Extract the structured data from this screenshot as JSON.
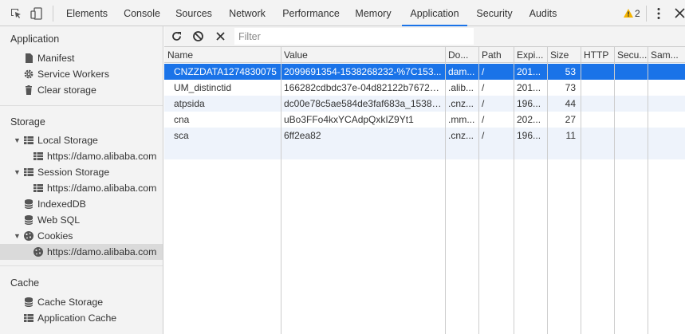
{
  "toolbar_tabs": [
    "Elements",
    "Console",
    "Sources",
    "Network",
    "Performance",
    "Memory",
    "Application",
    "Security",
    "Audits"
  ],
  "active_tab": "Application",
  "warning_count": "2",
  "colors": {
    "accent": "#1a73e8",
    "warning": "#f5b400",
    "selected_row": "#1a73e8"
  },
  "sidebar": {
    "application": {
      "title": "Application",
      "items": [
        "Manifest",
        "Service Workers",
        "Clear storage"
      ]
    },
    "storage": {
      "title": "Storage",
      "local_storage": {
        "label": "Local Storage",
        "child": "https://damo.alibaba.com"
      },
      "session_storage": {
        "label": "Session Storage",
        "child": "https://damo.alibaba.com"
      },
      "indexeddb": "IndexedDB",
      "websql": "Web SQL",
      "cookies": {
        "label": "Cookies",
        "child": "https://damo.alibaba.com"
      }
    },
    "cache": {
      "title": "Cache",
      "items": [
        "Cache Storage",
        "Application Cache"
      ]
    }
  },
  "cookie_toolbar": {
    "filter_placeholder": "Filter",
    "icons": [
      "refresh-icon",
      "clear-all-icon",
      "delete-selected-icon"
    ]
  },
  "table": {
    "columns": [
      "Name",
      "Value",
      "Do...",
      "Path",
      "Expi...",
      "Size",
      "HTTP",
      "Secu...",
      "Sam..."
    ],
    "rows": [
      {
        "name": "CNZZDATA1274830075",
        "value": "2099691354-1538268232-%7C153...",
        "domain": "dam...",
        "path": "/",
        "expires": "201...",
        "size": "53",
        "http": "",
        "secure": "",
        "samesite": ""
      },
      {
        "name": "UM_distinctid",
        "value": "166282cdbdc37e-04d82122b7672e...",
        "domain": ".alib...",
        "path": "/",
        "expires": "201...",
        "size": "73",
        "http": "",
        "secure": "",
        "samesite": ""
      },
      {
        "name": "atpsida",
        "value": "dc00e78c5ae584de3faf683a_15382...",
        "domain": ".cnz...",
        "path": "/",
        "expires": "196...",
        "size": "44",
        "http": "",
        "secure": "",
        "samesite": ""
      },
      {
        "name": "cna",
        "value": "uBo3FFo4kxYCAdpQxkIZ9Yt1",
        "domain": ".mm...",
        "path": "/",
        "expires": "202...",
        "size": "27",
        "http": "",
        "secure": "",
        "samesite": ""
      },
      {
        "name": "sca",
        "value": "6ff2ea82",
        "domain": ".cnz...",
        "path": "/",
        "expires": "196...",
        "size": "11",
        "http": "",
        "secure": "",
        "samesite": ""
      }
    ]
  }
}
